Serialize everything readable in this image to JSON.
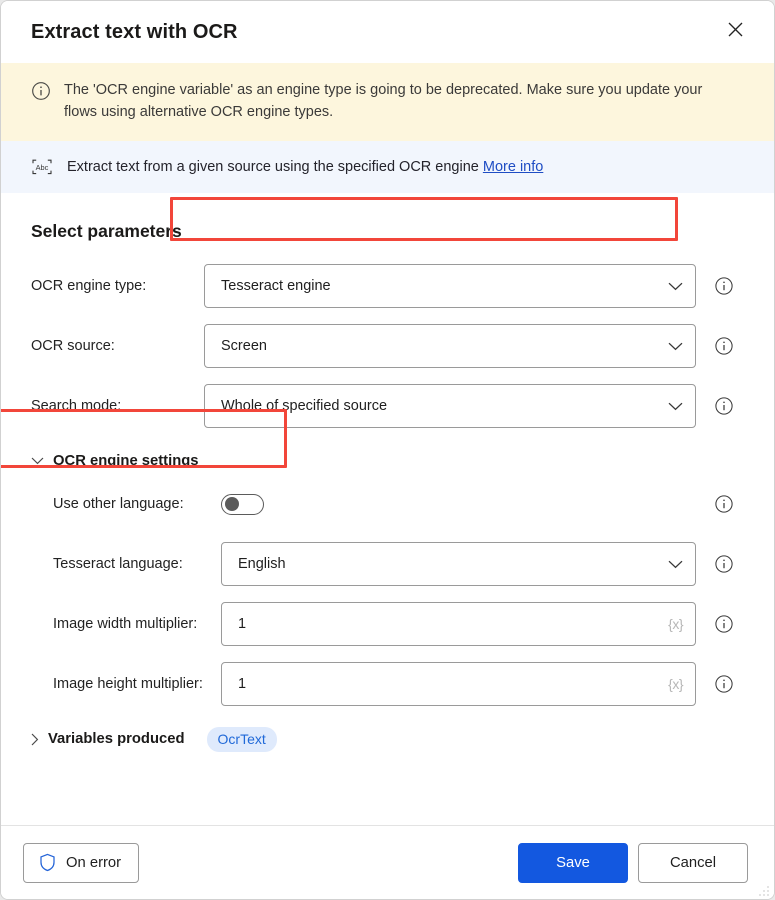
{
  "dialog": {
    "title": "Extract text with OCR",
    "close_icon": "close-icon"
  },
  "warning": {
    "icon": "info-circle-icon",
    "text": "The 'OCR engine variable' as an engine type is going to be deprecated.  Make sure you update your flows using alternative OCR engine types."
  },
  "description": {
    "icon": "abc-scan-icon",
    "text": "Extract text from a given source using the specified OCR engine",
    "link_label": "More info"
  },
  "section": {
    "title": "Select parameters"
  },
  "fields": [
    {
      "label": "OCR engine type:",
      "value": "Tesseract engine",
      "control": "dropdown",
      "name": "ocr-engine-type",
      "highlighted": true
    },
    {
      "label": "OCR source:",
      "value": "Screen",
      "control": "dropdown",
      "name": "ocr-source",
      "highlighted": false
    },
    {
      "label": "Search mode:",
      "value": "Whole of specified source",
      "control": "dropdown",
      "name": "search-mode",
      "highlighted": false
    }
  ],
  "engine_settings": {
    "header": "OCR engine settings",
    "expanded": true,
    "chevron": "chevron-down-icon",
    "toggle": {
      "label": "Use other language:",
      "state": "off",
      "highlighted": true
    },
    "fields": [
      {
        "label": "Tesseract language:",
        "value": "English",
        "control": "dropdown",
        "name": "tesseract-language"
      },
      {
        "label": "Image width multiplier:",
        "value": "1",
        "control": "text",
        "variable_glyph": "{x}",
        "name": "image-width-multiplier"
      },
      {
        "label": "Image height multiplier:",
        "value": "1",
        "control": "text",
        "variable_glyph": "{x}",
        "name": "image-height-multiplier"
      }
    ]
  },
  "variables_produced": {
    "header": "Variables produced",
    "expanded": false,
    "chevron": "chevron-right-icon",
    "pill": "OcrText"
  },
  "footer": {
    "on_error_label": "On error",
    "on_error_icon": "shield-icon",
    "save_label": "Save",
    "cancel_label": "Cancel"
  },
  "colors": {
    "accent": "#1358e0",
    "warning_bg": "#fdf6dd",
    "info_bg": "#f2f6fd",
    "link": "#1f4dc4",
    "highlight": "#f2463a",
    "pill_bg": "#dfeafc",
    "pill_text": "#2069d8"
  },
  "info_icon_name": "info-icon"
}
